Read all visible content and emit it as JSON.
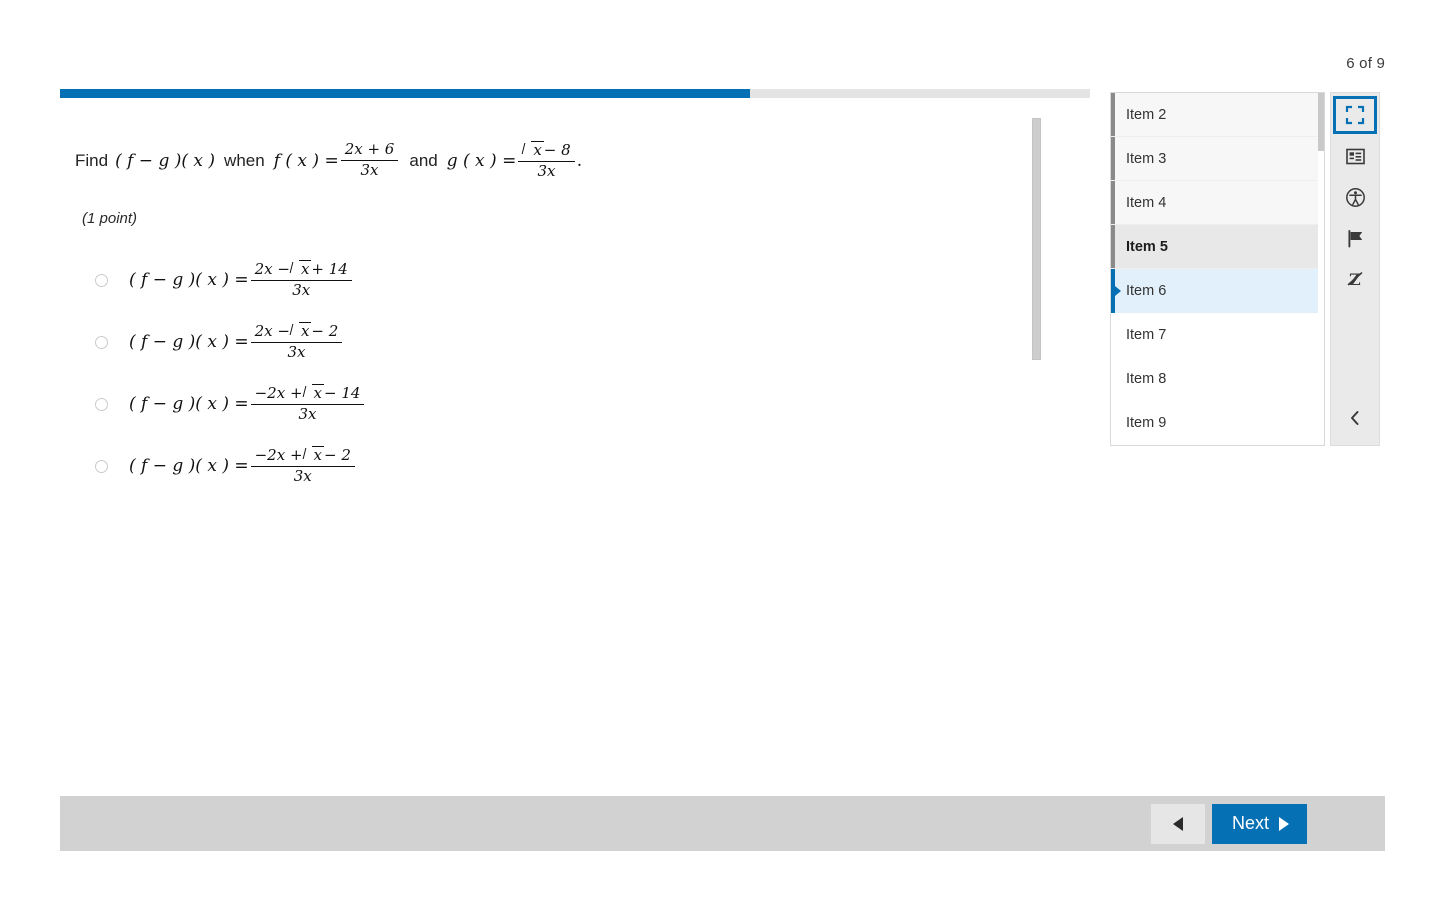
{
  "header": {
    "item_counter": "6 of 9"
  },
  "progress": {
    "percent": 67,
    "fill_color": "#0670b4",
    "track_color": "#e4e4e4"
  },
  "question": {
    "lead": "Find",
    "expr_fg": "( f − g )( x )",
    "when": "when",
    "f_label": "f ( x ) =",
    "f_numerator": "2x + 6",
    "f_denominator": "3x",
    "and": "and",
    "g_label": "g ( x ) =",
    "g_numerator_sqrt": "x",
    "g_numerator_rest": "− 8",
    "g_denominator": "3x",
    "period": ".",
    "points": "(1 point)"
  },
  "options": [
    {
      "id": "option-a",
      "lhs": "( f − g )( x ) =",
      "num_pre": "2x −",
      "num_sqrt": "x",
      "num_post": "+ 14",
      "den": "3x",
      "selected": false
    },
    {
      "id": "option-b",
      "lhs": "( f − g )( x ) =",
      "num_pre": "2x −",
      "num_sqrt": "x",
      "num_post": "− 2",
      "den": "3x",
      "selected": false
    },
    {
      "id": "option-c",
      "lhs": "( f − g )( x ) =",
      "num_pre": "−2x +",
      "num_sqrt": "x",
      "num_post": "− 14",
      "den": "3x",
      "selected": false
    },
    {
      "id": "option-d",
      "lhs": "( f − g )( x ) =",
      "num_pre": "−2x +",
      "num_sqrt": "x",
      "num_post": "− 2",
      "den": "3x",
      "selected": false
    }
  ],
  "item_panel": {
    "items": [
      {
        "label": "Item 2",
        "state": "answered"
      },
      {
        "label": "Item 3",
        "state": "answered"
      },
      {
        "label": "Item 4",
        "state": "answered"
      },
      {
        "label": "Item 5",
        "state": "visited-current"
      },
      {
        "label": "Item 6",
        "state": "active"
      },
      {
        "label": "Item 7",
        "state": "unvisited"
      },
      {
        "label": "Item 8",
        "state": "unvisited"
      },
      {
        "label": "Item 9",
        "state": "unvisited"
      }
    ],
    "active_color": "#0670b4",
    "active_bg": "#e1f0fb"
  },
  "toolbar": {
    "tools": [
      {
        "name": "fullscreen-icon",
        "label": "Full screen",
        "selected": true
      },
      {
        "name": "notes-icon",
        "label": "Item details",
        "selected": false
      },
      {
        "name": "accessibility-icon",
        "label": "Accessibility",
        "selected": false
      },
      {
        "name": "flag-icon",
        "label": "Flag item",
        "selected": false
      },
      {
        "name": "strikethrough-icon",
        "label": "Answer eliminator",
        "selected": false
      }
    ],
    "collapse_label": "Collapse panel"
  },
  "footer": {
    "prev_label": "",
    "next_label": "Next",
    "next_bg": "#0670b4"
  }
}
